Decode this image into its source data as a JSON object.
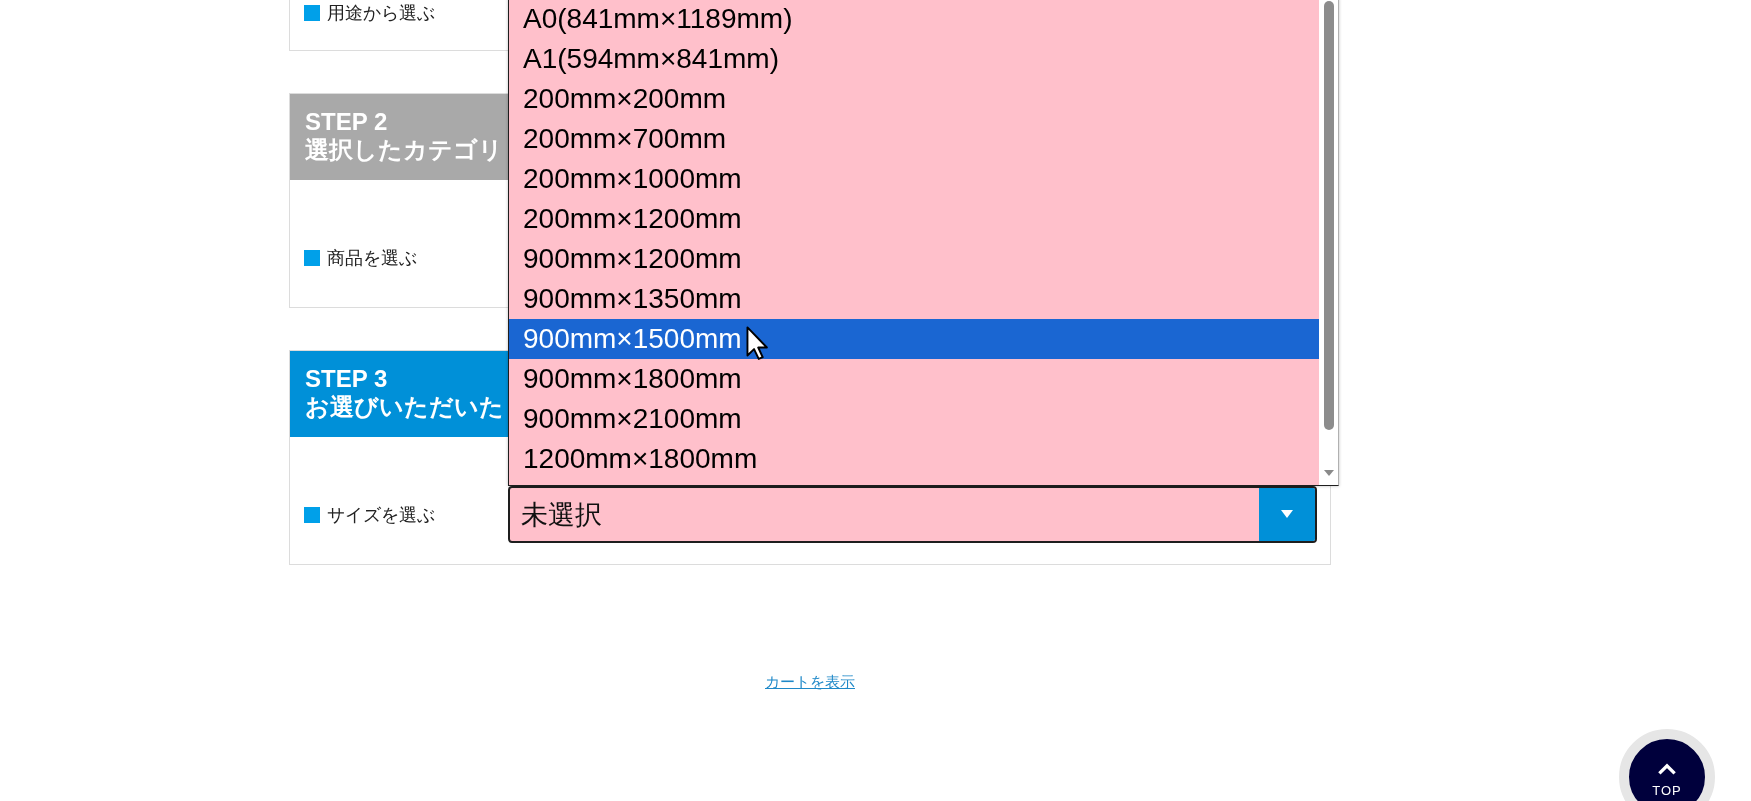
{
  "steps": [
    {
      "label": "用途から選ぶ"
    },
    {
      "header": {
        "step": "STEP 2",
        "title": "選択したカテゴリ",
        "active": false
      },
      "label": "商品を選ぶ"
    },
    {
      "header": {
        "step": "STEP 3",
        "title": "お選びいただいた",
        "active": true
      },
      "label": "サイズを選ぶ",
      "select": {
        "value": "未選択",
        "open": true,
        "options": [
          {
            "label": "A0(841mm×1189mm)",
            "selected": false
          },
          {
            "label": "A1(594mm×841mm)",
            "selected": false
          },
          {
            "label": "200mm×200mm",
            "selected": false
          },
          {
            "label": "200mm×700mm",
            "selected": false
          },
          {
            "label": "200mm×1000mm",
            "selected": false
          },
          {
            "label": "200mm×1200mm",
            "selected": false
          },
          {
            "label": "900mm×1200mm",
            "selected": false
          },
          {
            "label": "900mm×1350mm",
            "selected": false
          },
          {
            "label": "900mm×1500mm",
            "selected": true
          },
          {
            "label": "900mm×1800mm",
            "selected": false
          },
          {
            "label": "900mm×2100mm",
            "selected": false
          },
          {
            "label": "1200mm×1800mm",
            "selected": false
          }
        ]
      }
    }
  ],
  "cart_link": "カートを表示",
  "top_button": "TOP"
}
